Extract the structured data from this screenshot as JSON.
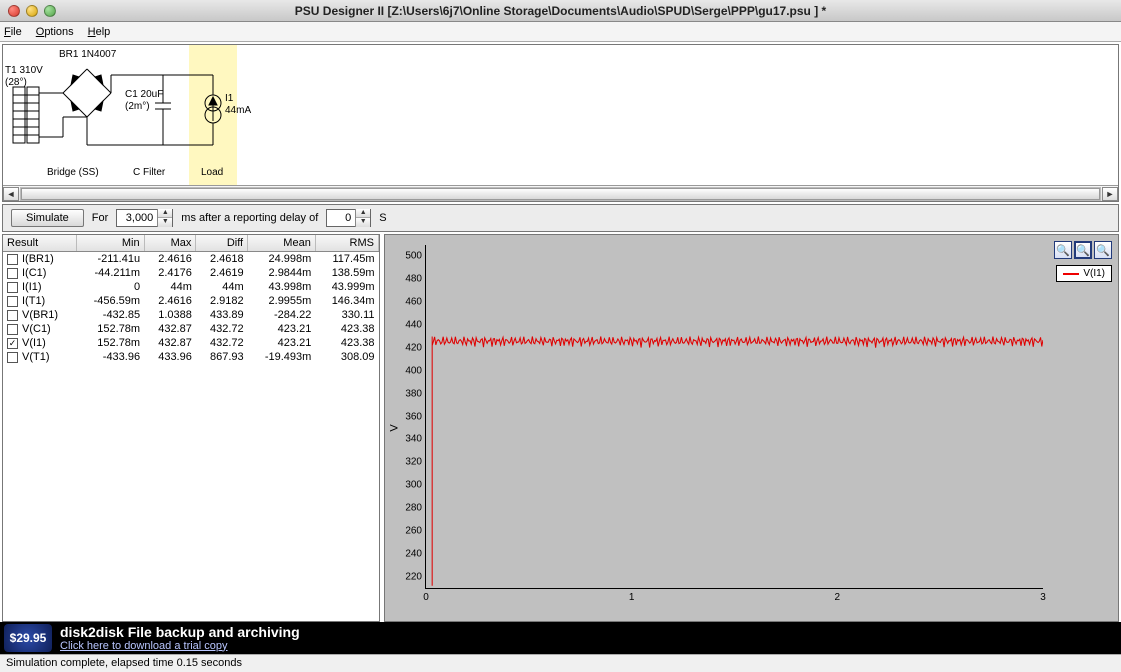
{
  "window": {
    "title": "PSU Designer II  [Z:\\Users\\6j7\\Online Storage\\Documents\\Audio\\SPUD\\Serge\\PPP\\gu17.psu ] *"
  },
  "menubar": {
    "file": "File",
    "options": "Options",
    "help": "Help"
  },
  "schematic": {
    "t1_label1": "T1 310V",
    "t1_label2": "(28°)",
    "br1_label": "BR1 1N4007",
    "c1_label1": "C1 20uF",
    "c1_label2": "(2m°)",
    "i1_label1": "I1",
    "i1_label2": "44mA",
    "footer_bridge": "Bridge (SS)",
    "footer_cfilter": "C Filter",
    "footer_load": "Load"
  },
  "simbar": {
    "simulate": "Simulate",
    "for": "For",
    "ms_value": "3,000",
    "ms_label": "ms  after a reporting delay of",
    "delay_value": "0",
    "s_label": "S"
  },
  "results": {
    "headers": [
      "Result",
      "Min",
      "Max",
      "Diff",
      "Mean",
      "RMS"
    ],
    "rows": [
      {
        "checked": false,
        "name": "I(BR1)",
        "min": "-211.41u",
        "max": "2.4616",
        "diff": "2.4618",
        "mean": "24.998m",
        "rms": "117.45m"
      },
      {
        "checked": false,
        "name": "I(C1)",
        "min": "-44.211m",
        "max": "2.4176",
        "diff": "2.4619",
        "mean": "2.9844m",
        "rms": "138.59m"
      },
      {
        "checked": false,
        "name": "I(I1)",
        "min": "0",
        "max": "44m",
        "diff": "44m",
        "mean": "43.998m",
        "rms": "43.999m"
      },
      {
        "checked": false,
        "name": "I(T1)",
        "min": "-456.59m",
        "max": "2.4616",
        "diff": "2.9182",
        "mean": "2.9955m",
        "rms": "146.34m"
      },
      {
        "checked": false,
        "name": "V(BR1)",
        "min": "-432.85",
        "max": "1.0388",
        "diff": "433.89",
        "mean": "-284.22",
        "rms": "330.11"
      },
      {
        "checked": false,
        "name": "V(C1)",
        "min": "152.78m",
        "max": "432.87",
        "diff": "432.72",
        "mean": "423.21",
        "rms": "423.38"
      },
      {
        "checked": true,
        "name": "V(I1)",
        "min": "152.78m",
        "max": "432.87",
        "diff": "432.72",
        "mean": "423.21",
        "rms": "423.38"
      },
      {
        "checked": false,
        "name": "V(T1)",
        "min": "-433.96",
        "max": "433.96",
        "diff": "867.93",
        "mean": "-19.493m",
        "rms": "308.09"
      }
    ]
  },
  "plot": {
    "ylabel": "V",
    "yticks": [
      "500",
      "480",
      "460",
      "440",
      "420",
      "400",
      "380",
      "360",
      "340",
      "320",
      "300",
      "280",
      "260",
      "240",
      "220"
    ],
    "xticks": [
      "0",
      "1",
      "2",
      "3"
    ],
    "legend": "V(I1)"
  },
  "chart_data": {
    "type": "line",
    "title": "",
    "xlabel": "",
    "ylabel": "V",
    "xlim": [
      0,
      3
    ],
    "ylim": [
      210,
      510
    ],
    "series": [
      {
        "name": "V(I1)",
        "color": "#e00000",
        "description": "Rises sharply from ~0 at x≈0 to ~430 V, then oscillates (ripple) roughly between ~418 V and ~432 V for 0 < x ≤ 3."
      }
    ]
  },
  "banner": {
    "price": "$29.95",
    "line1": "disk2disk File backup and archiving",
    "line2": "Click here to download a trial copy"
  },
  "status": "Simulation complete, elapsed time 0.15 seconds"
}
